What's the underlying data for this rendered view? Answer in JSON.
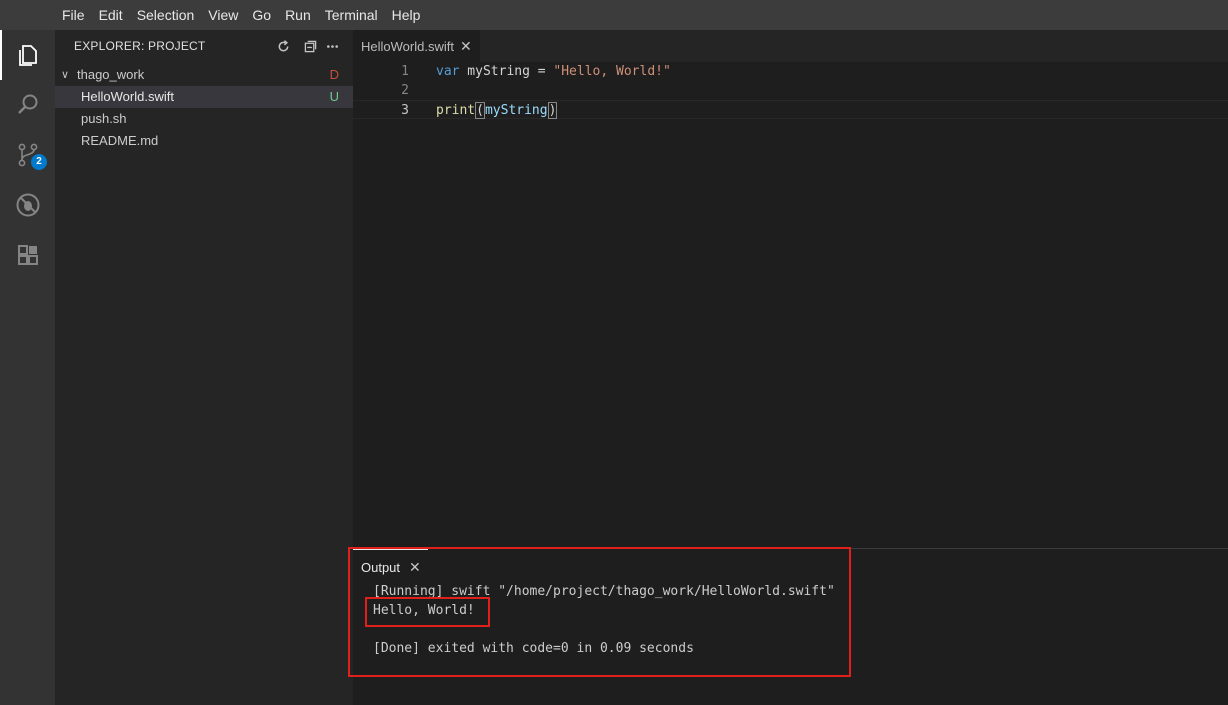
{
  "menu": [
    "File",
    "Edit",
    "Selection",
    "View",
    "Go",
    "Run",
    "Terminal",
    "Help"
  ],
  "activity": {
    "source_control_badge": "2"
  },
  "sidebar": {
    "title": "EXPLORER: PROJECT",
    "folder": {
      "name": "thago_work",
      "status": "D"
    },
    "files": [
      {
        "name": "HelloWorld.swift",
        "status": "U"
      },
      {
        "name": "push.sh",
        "status": ""
      },
      {
        "name": "README.md",
        "status": ""
      }
    ]
  },
  "editor": {
    "tab_label": "HelloWorld.swift",
    "lines": [
      {
        "num": "1"
      },
      {
        "num": "2"
      },
      {
        "num": "3"
      }
    ],
    "code": {
      "l1_kw": "var",
      "l1_name": " myString = ",
      "l1_str": "\"Hello, World!\"",
      "l3_fn": "print",
      "l3_open": "(",
      "l3_arg": "myString",
      "l3_close": ")"
    }
  },
  "panel": {
    "tab_label": "Output",
    "output_lines": [
      "[Running] swift \"/home/project/thago_work/HelloWorld.swift\"",
      "Hello, World!",
      "",
      "[Done] exited with code=0 in 0.09 seconds"
    ]
  },
  "colors": {
    "accent": "#007acc",
    "highlight": "#e0201a",
    "status_deleted": "#c74e39",
    "status_untracked": "#73c991"
  }
}
